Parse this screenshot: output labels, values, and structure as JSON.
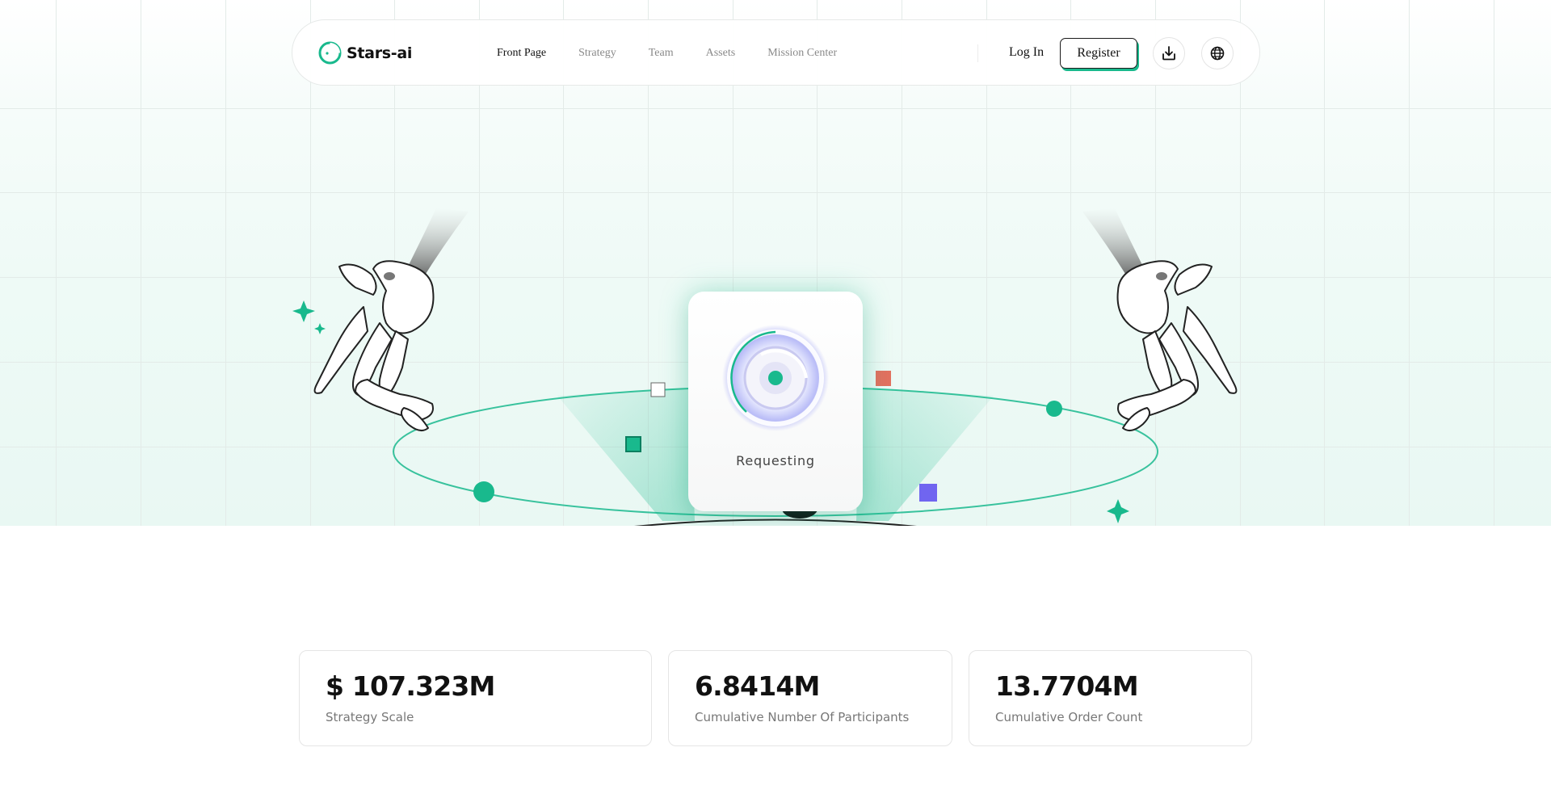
{
  "brand": {
    "name": "Stars-ai",
    "accent": "#19b98d"
  },
  "nav": {
    "items": [
      {
        "label": "Front Page",
        "active": true
      },
      {
        "label": "Strategy",
        "active": false
      },
      {
        "label": "Team",
        "active": false
      },
      {
        "label": "Assets",
        "active": false
      },
      {
        "label": "Mission Center",
        "active": false
      }
    ]
  },
  "auth": {
    "login_label": "Log In",
    "register_label": "Register"
  },
  "header_icons": {
    "download": "download-icon",
    "language": "globe-icon"
  },
  "hero": {
    "status_label": "Requesting",
    "colors": {
      "green": "#19b98d",
      "coral": "#e2705f",
      "violet": "#7065f0"
    }
  },
  "stats": [
    {
      "value": "$ 107.323M",
      "label": "Strategy Scale"
    },
    {
      "value": "6.8414M",
      "label": "Cumulative Number Of Participants"
    },
    {
      "value": "13.7704M",
      "label": "Cumulative Order Count"
    }
  ]
}
